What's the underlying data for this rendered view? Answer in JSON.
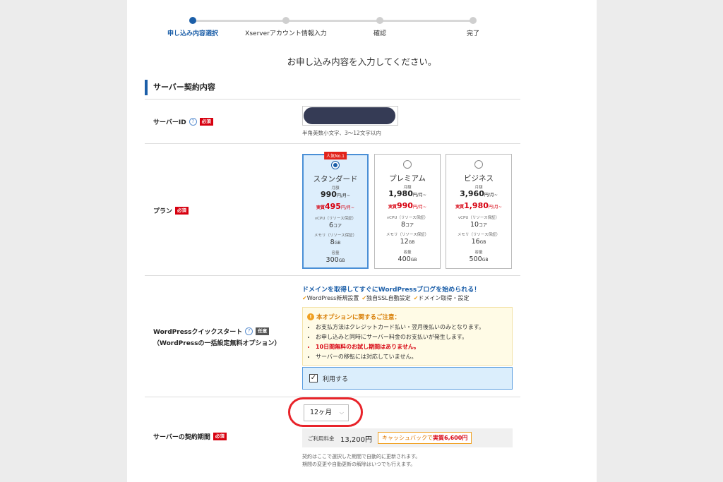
{
  "steps": [
    {
      "label": "申し込み内容選択",
      "active": true
    },
    {
      "label": "Xserverアカウント情報入力",
      "active": false
    },
    {
      "label": "確認",
      "active": false
    },
    {
      "label": "完了",
      "active": false
    }
  ],
  "instruction": "お申し込み内容を入力してください。",
  "section_title": "サーバー契約内容",
  "required_badge": "必須",
  "optional_badge": "任意",
  "help_glyph": "?",
  "server_id": {
    "label": "サーバーID",
    "hint": "半角英数小文字、3～12文字以内"
  },
  "plan": {
    "label": "プラン",
    "monthly_label": "月額",
    "effective_label": "実質",
    "price_unit": "円/月~",
    "cpu_label": "vCPU（リソース保証）",
    "cpu_unit": "コア",
    "memory_label": "メモリ（リソース保証）",
    "memory_unit": "GB",
    "storage_label": "容量",
    "storage_unit": "GB",
    "options": [
      {
        "name": "スタンダード",
        "badge": "人気No.1",
        "selected": true,
        "price": "990",
        "effective": "495",
        "cpu": "6",
        "memory": "8",
        "storage": "300"
      },
      {
        "name": "プレミアム",
        "badge": "",
        "selected": false,
        "price": "1,980",
        "effective": "990",
        "cpu": "8",
        "memory": "12",
        "storage": "400"
      },
      {
        "name": "ビジネス",
        "badge": "",
        "selected": false,
        "price": "3,960",
        "effective": "1,980",
        "cpu": "10",
        "memory": "16",
        "storage": "500"
      }
    ]
  },
  "wordpress": {
    "label_line1": "WordPressクイックスタート",
    "label_line2": "（WordPressの一括設定無料オプション）",
    "promo": "ドメインを取得してすぐにWordPressブログを始められる！",
    "features": [
      "WordPress新規設置",
      "独自SSL自動設定",
      "ドメイン取得・設定"
    ],
    "notice_title": "本オプションに関するご注意：",
    "notice_items": [
      "お支払方法はクレジットカード払い・翌月後払いのみとなります。",
      "お申し込みと同時にサーバー料金のお支払いが発生します。",
      "10日間無料のお試し期間はありません。",
      "サーバーの移転には対応していません。"
    ],
    "use_label": "利用する",
    "checked": true
  },
  "term": {
    "label": "サーバーの契約期間",
    "selected": "12ヶ月",
    "fee_label": "ご利用料金",
    "fee_amount": "13,200円",
    "cashback_prefix": "キャッシュバックで",
    "cashback_value": "実質6,600円",
    "note_line1": "契約はここで選択した期間で自動的に更新されます。",
    "note_line2": "期間の変更や自動更新の解除はいつでも行えます。"
  },
  "colors": {
    "accent": "#1b5ea8",
    "required": "#d7000f",
    "highlight_ring": "#e8232a",
    "selected_plan_bg": "#ddeefc"
  }
}
